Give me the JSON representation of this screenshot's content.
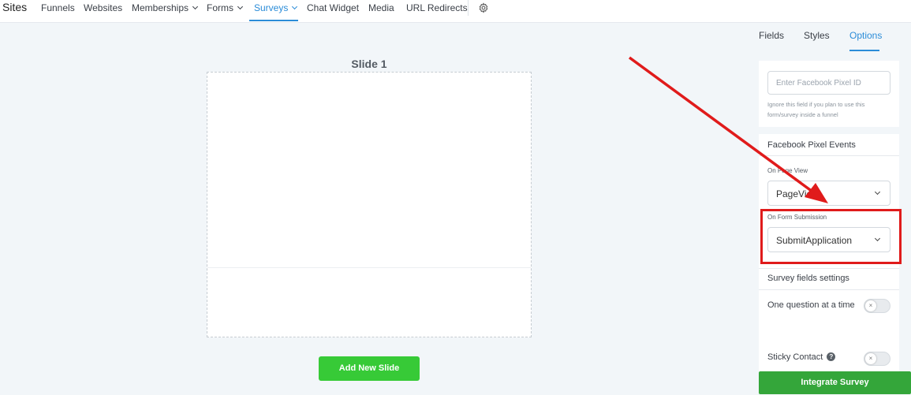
{
  "nav": {
    "sites": "Sites",
    "funnels": "Funnels",
    "websites": "Websites",
    "memberships": "Memberships",
    "forms": "Forms",
    "surveys": "Surveys",
    "chat_widget": "Chat Widget",
    "media": "Media",
    "url_redirects": "URL Redirects",
    "accent": "#2b8cd8"
  },
  "canvas": {
    "slide_title": "Slide 1",
    "add_slide_label": "Add New Slide"
  },
  "panel": {
    "tabs": {
      "fields": "Fields",
      "styles": "Styles",
      "options": "Options"
    },
    "pixel_id_placeholder": "Enter Facebook Pixel ID",
    "pixel_hint": "Ignore this field if you plan to use this form/survey inside a funnel",
    "pixel_events_title": "Facebook Pixel Events",
    "on_page_view_label": "On Page View",
    "on_page_view_value": "PageView",
    "on_form_submission_label": "On Form Submission",
    "on_form_submission_value": "SubmitApplication",
    "survey_fields_settings": "Survey fields settings",
    "one_question_label": "One question at a time",
    "sticky_contact_label": "Sticky Contact",
    "integrate_label": "Integrate Survey"
  },
  "annotation": {
    "color": "#e01b1b"
  }
}
